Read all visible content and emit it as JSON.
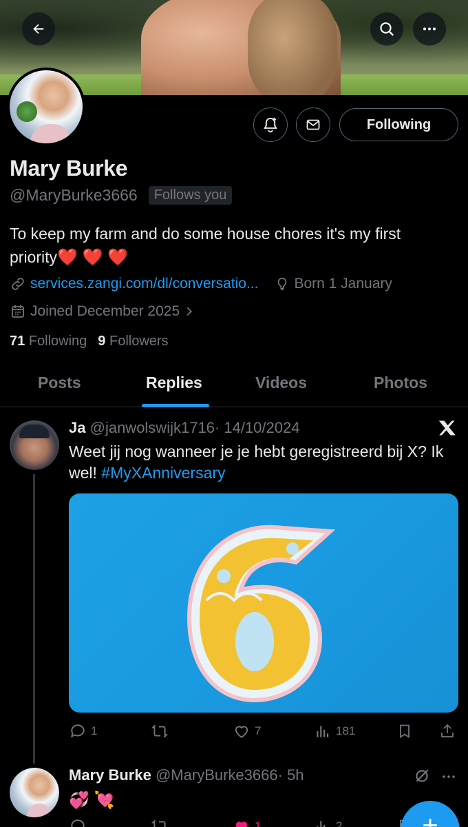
{
  "profile": {
    "name": "Mary Burke",
    "handle": "@MaryBurke3666",
    "follows_you": "Follows you",
    "bio": "To keep my farm and do some house chores it's my first priority",
    "bio_emoji": "❤️ ❤️ ❤️",
    "link": "services.zangi.com/dl/conversatio...",
    "born": "Born 1 January",
    "joined": "Joined December 2025",
    "following_count": "71",
    "following_label": "Following",
    "followers_count": "9",
    "followers_label": "Followers"
  },
  "actions": {
    "following_button": "Following"
  },
  "tabs": [
    {
      "label": "Posts",
      "active": false
    },
    {
      "label": "Replies",
      "active": true
    },
    {
      "label": "Videos",
      "active": false
    },
    {
      "label": "Photos",
      "active": false
    }
  ],
  "tweets": [
    {
      "author": "Ja",
      "handle": "@janwolswijk1716",
      "time": "· 14/10/2024",
      "text": "Weet jij nog wanneer je je hebt geregistreerd bij X? Ik wel!",
      "hashtag": "#MyXAnniversary",
      "media_number": "6",
      "replies": "1",
      "retweets": "",
      "likes": "7",
      "views": "181"
    },
    {
      "author": "Mary Burke",
      "handle": "@MaryBurke3666",
      "time": "· 5h",
      "text": "💞 💘",
      "replies": "",
      "retweets": "",
      "likes": "1",
      "views": "2"
    }
  ],
  "colors": {
    "accent": "#1d9bf0",
    "background": "#000000",
    "muted": "#71767b",
    "heart": "#f91f32"
  },
  "icons": [
    "back-arrow-icon",
    "search-icon",
    "more-icon",
    "notification-bell-icon",
    "mail-icon",
    "link-icon",
    "location-pin-icon",
    "calendar-icon",
    "chevron-right-icon",
    "x-logo-icon",
    "reply-icon",
    "retweet-icon",
    "like-icon",
    "views-icon",
    "bookmark-icon",
    "share-icon",
    "grok-icon",
    "compose-icon"
  ]
}
